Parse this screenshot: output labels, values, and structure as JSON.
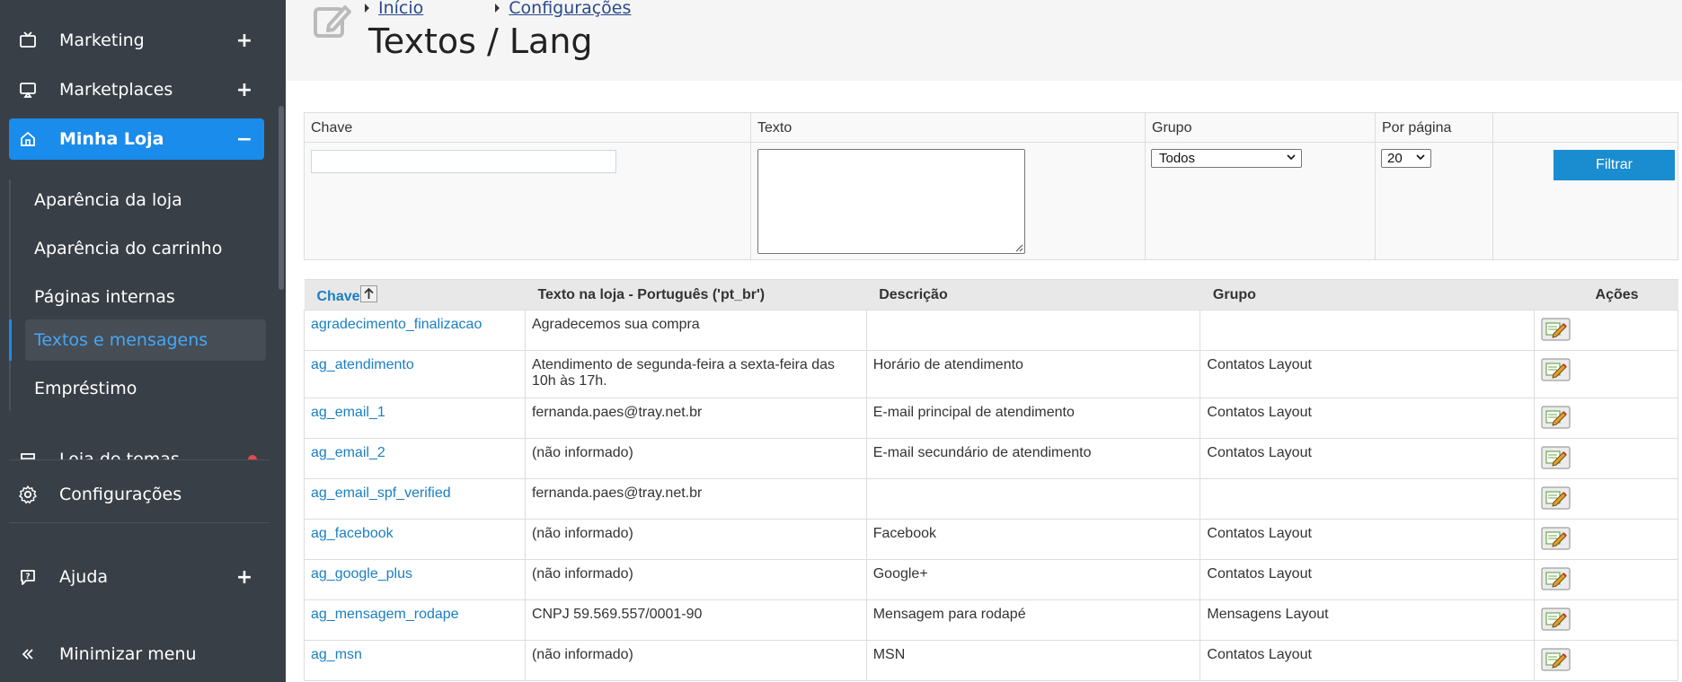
{
  "sidebar": {
    "items": [
      {
        "label": "Marketing",
        "toggle": "+"
      },
      {
        "label": "Marketplaces",
        "toggle": "+"
      },
      {
        "label": "Minha Loja",
        "toggle": "−"
      }
    ],
    "submenu": [
      {
        "label": "Aparência da loja"
      },
      {
        "label": "Aparência do carrinho"
      },
      {
        "label": "Páginas internas"
      },
      {
        "label": "Textos e mensagens"
      },
      {
        "label": "Empréstimo"
      }
    ],
    "partial_item": "Loja de temas",
    "config_label": "Configurações",
    "help_label": "Ajuda",
    "help_toggle": "+",
    "minimize_label": "Minimizar menu",
    "accent": "#1a8cec",
    "background": "#393f47"
  },
  "header": {
    "breadcrumb": [
      "Início",
      "Configurações"
    ],
    "title": "Textos / Lang"
  },
  "filter": {
    "headers": {
      "chave": "Chave",
      "texto": "Texto",
      "grupo": "Grupo",
      "por_pagina": "Por página"
    },
    "chave_value": "",
    "texto_value": "",
    "grupo_selected": "Todos",
    "por_pagina_selected": "20",
    "button_label": "Filtrar"
  },
  "table": {
    "columns": {
      "chave": "Chave",
      "texto": "Texto na loja - Português ('pt_br')",
      "descricao": "Descrição",
      "grupo": "Grupo",
      "acoes": "Ações"
    },
    "rows": [
      {
        "key": "agradecimento_finalizacao",
        "text": "Agradecemos sua compra",
        "desc": "",
        "group": ""
      },
      {
        "key": "ag_atendimento",
        "text": "Atendimento de segunda-feira a sexta-feira das 10h às 17h.",
        "desc": "Horário de atendimento",
        "group": "Contatos Layout"
      },
      {
        "key": "ag_email_1",
        "text": "fernanda.paes@tray.net.br",
        "desc": "E-mail principal de atendimento",
        "group": "Contatos Layout"
      },
      {
        "key": "ag_email_2",
        "text": "(não informado)",
        "desc": "E-mail secundário de atendimento",
        "group": "Contatos Layout"
      },
      {
        "key": "ag_email_spf_verified",
        "text": "fernanda.paes@tray.net.br",
        "desc": "",
        "group": ""
      },
      {
        "key": "ag_facebook",
        "text": "(não informado)",
        "desc": "Facebook",
        "group": "Contatos Layout"
      },
      {
        "key": "ag_google_plus",
        "text": "(não informado)",
        "desc": "Google+",
        "group": "Contatos Layout"
      },
      {
        "key": "ag_mensagem_rodape",
        "text": "CNPJ 59.569.557/0001-90",
        "desc": "Mensagem para rodapé",
        "group": "Mensagens Layout"
      },
      {
        "key": "ag_msn",
        "text": "(não informado)",
        "desc": "MSN",
        "group": "Contatos Layout"
      }
    ]
  }
}
